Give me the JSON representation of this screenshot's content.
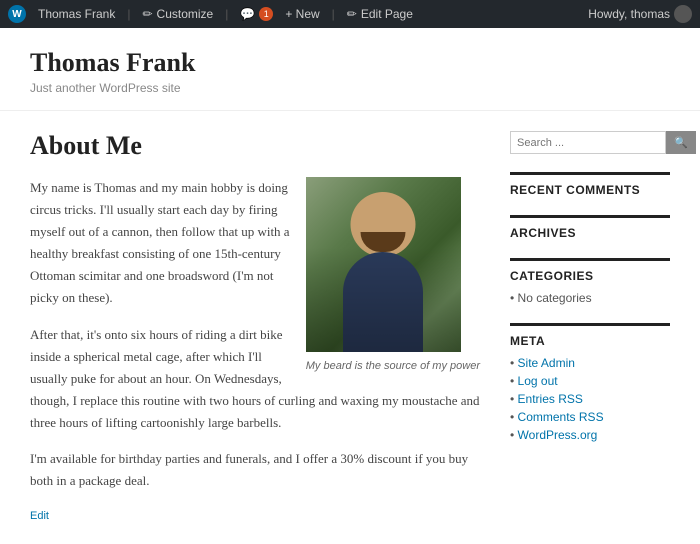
{
  "adminBar": {
    "wpLabel": "W",
    "siteTitle": "Thomas Frank",
    "customize": "Customize",
    "commentsCount": "1",
    "newLabel": "+ New",
    "editPage": "Edit Page",
    "howdy": "Howdy, thomas"
  },
  "header": {
    "siteTitle": "Thomas Frank",
    "tagline": "Just another WordPress site"
  },
  "main": {
    "pageTitle": "About Me",
    "paragraphs": [
      "My name is Thomas and my main hobby is doing circus tricks. I'll usually start each day by firing myself out of a cannon, then follow that up with a healthy breakfast consisting of one 15th-century Ottoman scimitar and one broadsword (I'm not picky on these).",
      "After that, it's onto six hours of riding a dirt bike inside a spherical metal cage, after which I'll usually puke for about an hour. On Wednesdays, though, I replace this routine with two hours of curling and waxing my moustache and three hours of lifting cartoonishly large barbells.",
      "I'm available for birthday parties and funerals, and I offer a 30% discount if you buy both in a package deal."
    ],
    "imgCaption": "My beard is the source of my power",
    "editLink": "Edit"
  },
  "sidebar": {
    "searchPlaceholder": "Search ...",
    "searchButton": "🔍",
    "sections": [
      {
        "id": "recent-comments",
        "title": "RECENT COMMENTS"
      },
      {
        "id": "archives",
        "title": "ARCHIVES"
      },
      {
        "id": "categories",
        "title": "CATEGORIES"
      },
      {
        "id": "meta",
        "title": "META"
      }
    ],
    "categories": {
      "empty": "No categories"
    },
    "meta": {
      "links": [
        "Site Admin",
        "Log out",
        "Entries RSS",
        "Comments RSS",
        "WordPress.org"
      ]
    }
  }
}
